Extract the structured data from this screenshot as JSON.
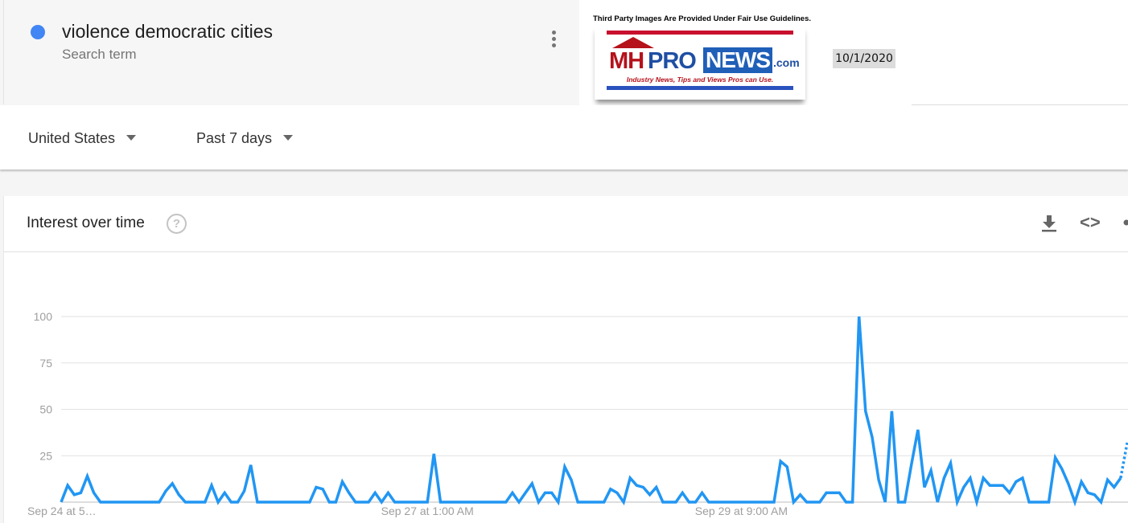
{
  "search_term": {
    "name": "violence democratic cities",
    "type_label": "Search term",
    "color": "#4285f4"
  },
  "overlay": {
    "fair_use_notice": "Third Party Images Are Provided Under Fair Use Guidelines.",
    "logo": {
      "mh": "MH",
      "pro": "PRO",
      "news": "NEWS",
      "com": ".com",
      "tagline": "Industry News, Tips and Views Pros can Use."
    },
    "date": "10/1/2020"
  },
  "filters": {
    "region": "United States",
    "time_range": "Past 7 days"
  },
  "panel": {
    "title": "Interest over time",
    "icons": [
      "help-icon",
      "download-icon",
      "embed-icon",
      "share-icon"
    ]
  },
  "chart_data": {
    "type": "line",
    "title": "Interest over time",
    "xlabel": "",
    "ylabel": "",
    "ylim": [
      0,
      100
    ],
    "yticks": [
      25,
      50,
      75,
      100
    ],
    "xtick_labels": [
      "Sep 24 at 5…",
      "Sep 27 at 1:00 AM",
      "Sep 29 at 9:00 AM"
    ],
    "xtick_indices": [
      0,
      56,
      104
    ],
    "grid": true,
    "legend": "none",
    "series": [
      {
        "name": "violence democratic cities",
        "color": "#2196f3",
        "partial_last_points": 1,
        "values": [
          0,
          9,
          4,
          5,
          14,
          5,
          0,
          0,
          0,
          0,
          0,
          0,
          0,
          0,
          0,
          0,
          6,
          10,
          4,
          0,
          0,
          0,
          0,
          9,
          0,
          5,
          0,
          0,
          6,
          20,
          0,
          0,
          0,
          0,
          0,
          0,
          0,
          0,
          0,
          8,
          7,
          0,
          0,
          11,
          5,
          0,
          0,
          0,
          5,
          0,
          5,
          0,
          0,
          0,
          0,
          0,
          0,
          26,
          0,
          0,
          0,
          0,
          0,
          0,
          0,
          0,
          0,
          0,
          0,
          5,
          0,
          5,
          10,
          0,
          5,
          5,
          0,
          19,
          12,
          0,
          0,
          0,
          0,
          0,
          7,
          5,
          0,
          13,
          9,
          8,
          4,
          8,
          0,
          0,
          0,
          5,
          0,
          0,
          5,
          0,
          0,
          0,
          0,
          0,
          0,
          0,
          0,
          0,
          0,
          0,
          22,
          19,
          0,
          4,
          0,
          0,
          0,
          5,
          5,
          5,
          0,
          0,
          100,
          49,
          35,
          12,
          0,
          49,
          0,
          0,
          20,
          39,
          8,
          17,
          0,
          13,
          21,
          0,
          8,
          13,
          0,
          13,
          9,
          9,
          9,
          5,
          11,
          13,
          0,
          0,
          0,
          0,
          24,
          18,
          10,
          0,
          11,
          5,
          4,
          0,
          12,
          8,
          13,
          32
        ]
      }
    ]
  }
}
